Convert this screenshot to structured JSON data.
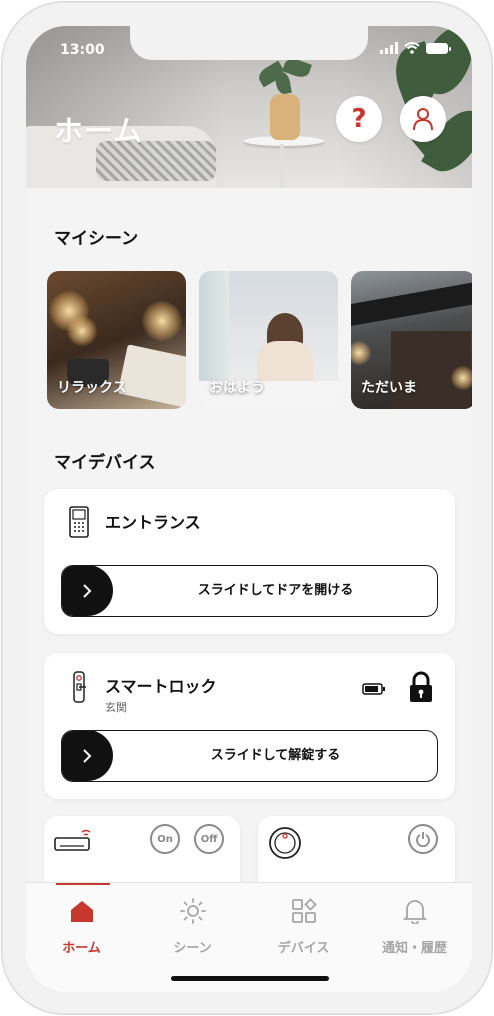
{
  "status_bar": {
    "time": "13:00"
  },
  "header": {
    "title": "ホーム",
    "help_icon": "question-icon",
    "account_icon": "user-icon"
  },
  "scenes": {
    "title": "マイシーン",
    "items": [
      {
        "label": "リラックス"
      },
      {
        "label": "おはよう"
      },
      {
        "label": "ただいま"
      }
    ]
  },
  "devices": {
    "title": "マイデバイス",
    "entrance": {
      "name": "エントランス",
      "slider_label": "スライドしてドアを開ける",
      "icon": "intercom-icon"
    },
    "smart_lock": {
      "name": "スマートロック",
      "location": "玄関",
      "slider_label": "スライドして解錠する",
      "icon": "door-lock-icon",
      "battery_icon": "battery-icon",
      "lock_state_icon": "padlock-icon"
    },
    "aircon": {
      "icon": "air-conditioner-icon",
      "on_label": "On",
      "off_label": "Off"
    },
    "robot_vacuum": {
      "icon": "robot-vacuum-icon",
      "power_icon": "power-icon"
    }
  },
  "tab_bar": {
    "active": "home",
    "tabs": [
      {
        "id": "home",
        "label": "ホーム",
        "icon": "home-icon"
      },
      {
        "id": "scene",
        "label": "シーン",
        "icon": "sun-icon"
      },
      {
        "id": "devices",
        "label": "デバイス",
        "icon": "grid-icon"
      },
      {
        "id": "notifications",
        "label": "通知・履歴",
        "icon": "bell-icon"
      }
    ]
  },
  "colors": {
    "accent": "#c8372d",
    "text": "#111111",
    "muted": "#a5a5a5",
    "background": "#f4f4f4"
  }
}
